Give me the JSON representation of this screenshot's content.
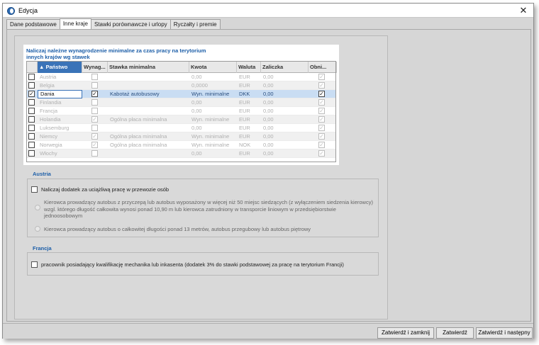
{
  "window": {
    "title": "Edycja"
  },
  "tabs": [
    {
      "label": "Dane podstawowe"
    },
    {
      "label": "Inne kraje"
    },
    {
      "label": "Stawki porównawcze i urlopy"
    },
    {
      "label": "Ryczałty i premie"
    }
  ],
  "grid": {
    "title": "Naliczaj należne wynagrodzenie minimalne za czas pracy na terytorium innych krajów wg stawek",
    "columns": [
      "▲ Państwo",
      "Wynag...",
      "Stawka minimalna",
      "Kwota",
      "Waluta",
      "Zaliczka",
      "Obni..."
    ],
    "rows": [
      {
        "checked": false,
        "country": "Austria",
        "wynag": false,
        "stawka": "",
        "kwota": "0,00",
        "waluta": "EUR",
        "zaliczka": "0,00",
        "obni": true,
        "selected": false
      },
      {
        "checked": false,
        "country": "Belgia",
        "wynag": false,
        "stawka": "",
        "kwota": "0,0000",
        "waluta": "EUR",
        "zaliczka": "0,00",
        "obni": true,
        "selected": false
      },
      {
        "checked": true,
        "country": "Dania",
        "wynag": true,
        "stawka": "Kabotaż autobusowy",
        "kwota": "Wyn. minimalne",
        "waluta": "DKK",
        "zaliczka": "0,00",
        "obni": true,
        "selected": true
      },
      {
        "checked": false,
        "country": "Finlandia",
        "wynag": false,
        "stawka": "",
        "kwota": "0,00",
        "waluta": "EUR",
        "zaliczka": "0,00",
        "obni": true,
        "selected": false
      },
      {
        "checked": false,
        "country": "Francja",
        "wynag": false,
        "stawka": "",
        "kwota": "0,00",
        "waluta": "EUR",
        "zaliczka": "0,00",
        "obni": true,
        "selected": false
      },
      {
        "checked": false,
        "country": "Holandia",
        "wynag": true,
        "stawka": "Ogólna płaca minimalna",
        "kwota": "Wyn. minimalne",
        "waluta": "EUR",
        "zaliczka": "0,00",
        "obni": true,
        "selected": false
      },
      {
        "checked": false,
        "country": "Luksemburg",
        "wynag": false,
        "stawka": "",
        "kwota": "0,00",
        "waluta": "EUR",
        "zaliczka": "0,00",
        "obni": true,
        "selected": false
      },
      {
        "checked": false,
        "country": "Niemcy",
        "wynag": true,
        "stawka": "Ogólna płaca minimalna",
        "kwota": "Wyn. minimalne",
        "waluta": "EUR",
        "zaliczka": "0,00",
        "obni": true,
        "selected": false
      },
      {
        "checked": false,
        "country": "Norwegia",
        "wynag": true,
        "stawka": "Ogólna płaca minimalna",
        "kwota": "Wyn. minimalne",
        "waluta": "NOK",
        "zaliczka": "0,00",
        "obni": true,
        "selected": false
      },
      {
        "checked": false,
        "country": "Włochy",
        "wynag": false,
        "stawka": "",
        "kwota": "0,00",
        "waluta": "EUR",
        "zaliczka": "0,00",
        "obni": true,
        "selected": false
      }
    ]
  },
  "austria": {
    "title": "Austria",
    "checkbox_label": "Naliczaj dodatek za uciążliwą pracę w przewozie osób",
    "option1": "Kierowca prowadzący autobus z przyczepą lub autobus wyposażony w więcej niż 50 miejsc siedzących (z wyłączeniem siedzenia kierowcy) wzgl. którego długość całkowita wynosi ponad 10,90 m lub kierowca zatrudniony w transporcie liniowym w przedsiębiorstwie jednoosobowym",
    "option2": "Kierowca prowadzący autobus o całkowitej długości ponad 13 metrów, autobus przegubowy lub autobus piętrowy"
  },
  "francja": {
    "title": "Francja",
    "checkbox_label": "pracownik posiadający kwalifikację mechanika lub inkasenta (dodatek 3% do stawki podstawowej za pracę na terytorium Francji)"
  },
  "buttons": {
    "save_close": "Zatwierdź i zamknij",
    "save": "Zatwierdź",
    "save_next": "Zatwierdź i następny"
  }
}
